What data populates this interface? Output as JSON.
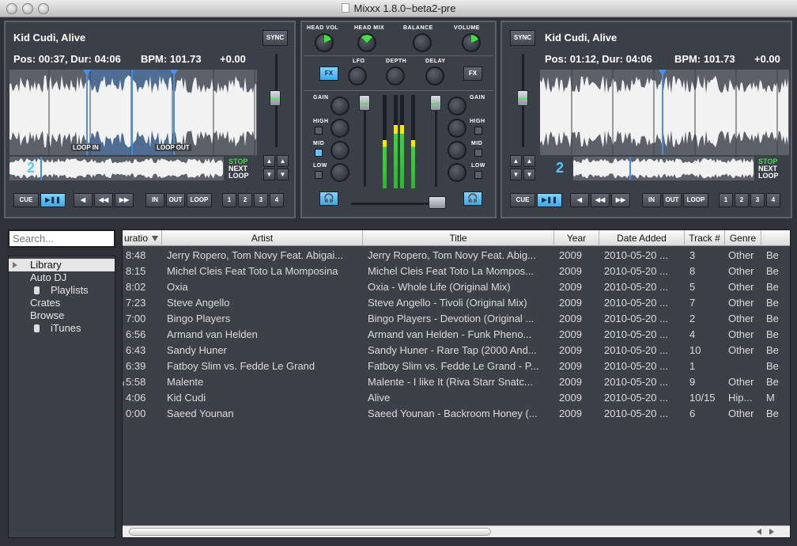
{
  "window": {
    "title": "Mixxx 1.8.0~beta2-pre"
  },
  "deck1": {
    "track": "Kid Cudi, Alive",
    "pos_label": "Pos: 00:37, Dur: 04:06",
    "bpm_label": "BPM: 101.73",
    "pitch": "+0.00",
    "sync": "SYNC",
    "loop_in": "LOOP IN",
    "loop_out": "LOOP OUT",
    "transport": [
      "STOP",
      "NEXT",
      "LOOP"
    ],
    "buttons": {
      "cue": "CUE",
      "play": "▶❚❚",
      "in": "IN",
      "out": "OUT",
      "loop": "LOOP",
      "hot": [
        "1",
        "2",
        "3",
        "4"
      ]
    },
    "overview_number": "2"
  },
  "deck2": {
    "track": "Kid Cudi, Alive",
    "pos_label": "Pos: 01:12, Dur: 04:06",
    "bpm_label": "BPM: 101.73",
    "pitch": "+0.00",
    "sync": "SYNC",
    "transport": [
      "STOP",
      "NEXT",
      "LOOP"
    ],
    "buttons": {
      "cue": "CUE",
      "play": "▶❚❚",
      "in": "IN",
      "out": "OUT",
      "loop": "LOOP",
      "hot": [
        "1",
        "2",
        "3",
        "4"
      ]
    },
    "overview_number": "2"
  },
  "mixer": {
    "head_vol": "HEAD VOL",
    "head_mix": "HEAD MIX",
    "balance": "BALANCE",
    "volume": "VOLUME",
    "fx": "FX",
    "lfo": "LFO",
    "depth": "DEPTH",
    "delay": "DELAY",
    "gain": "GAIN",
    "high": "HIGH",
    "mid": "MID",
    "low": "LOW"
  },
  "library": {
    "search_placeholder": "Search...",
    "tree": [
      {
        "label": "Library",
        "selected": true
      },
      {
        "label": "Auto DJ"
      },
      {
        "label": "Playlists"
      },
      {
        "label": "Crates"
      },
      {
        "label": "Browse"
      },
      {
        "label": "iTunes"
      }
    ],
    "columns": [
      "uratio",
      "Artist",
      "Title",
      "Year",
      "Date Added",
      "Track #",
      "Genre",
      ""
    ],
    "rows": [
      [
        "8:48",
        "Jerry Ropero, Tom Novy Feat. Abigai...",
        "Jerry Ropero, Tom Novy Feat. Abig...",
        "2009",
        "2010-05-20 ...",
        "3",
        "Other",
        "Be"
      ],
      [
        "8:15",
        "Michel Cleis Feat Toto La Momposina",
        "Michel Cleis Feat Toto La Mompos...",
        "2009",
        "2010-05-20 ...",
        "8",
        "Other",
        "Be"
      ],
      [
        "8:02",
        "Oxia",
        "Oxia - Whole Life (Original Mix)",
        "2009",
        "2010-05-20 ...",
        "5",
        "Other",
        "Be"
      ],
      [
        "7:23",
        "Steve Angello",
        "Steve Angello - Tivoli (Original Mix)",
        "2009",
        "2010-05-20 ...",
        "7",
        "Other",
        "Be"
      ],
      [
        "7:00",
        "Bingo Players",
        "Bingo Players - Devotion (Original ...",
        "2009",
        "2010-05-20 ...",
        "2",
        "Other",
        "Be"
      ],
      [
        "6:56",
        "Armand van Helden",
        "Armand van Helden - Funk Pheno...",
        "2009",
        "2010-05-20 ...",
        "4",
        "Other",
        "Be"
      ],
      [
        "6:43",
        "Sandy Huner",
        "Sandy Huner - Rare Tap (2000 And...",
        "2009",
        "2010-05-20 ...",
        "10",
        "Other",
        "Be"
      ],
      [
        "6:39",
        "Fatboy Slim vs. Fedde Le Grand",
        "Fatboy Slim vs. Fedde Le Grand - P...",
        "2009",
        "2010-05-20 ...",
        "1",
        "",
        "Be"
      ],
      [
        "5:58",
        "Malente",
        "Malente - I like It (Riva Starr Snatc...",
        "2009",
        "2010-05-20 ...",
        "9",
        "Other",
        "Be"
      ],
      [
        "4:06",
        "Kid Cudi",
        "Alive",
        "2009",
        "2010-05-20 ...",
        "10/15",
        "Hip...",
        "M"
      ],
      [
        "0:00",
        "Saeed Younan",
        "Saeed Younan - Backroom Honey (...",
        "2009",
        "2010-05-20 ...",
        "6",
        "Other",
        "Be"
      ]
    ]
  },
  "colors": {
    "accent": "#57c9ff",
    "green": "#41e043",
    "panel": "#3b4048",
    "background": "#2e3238"
  }
}
